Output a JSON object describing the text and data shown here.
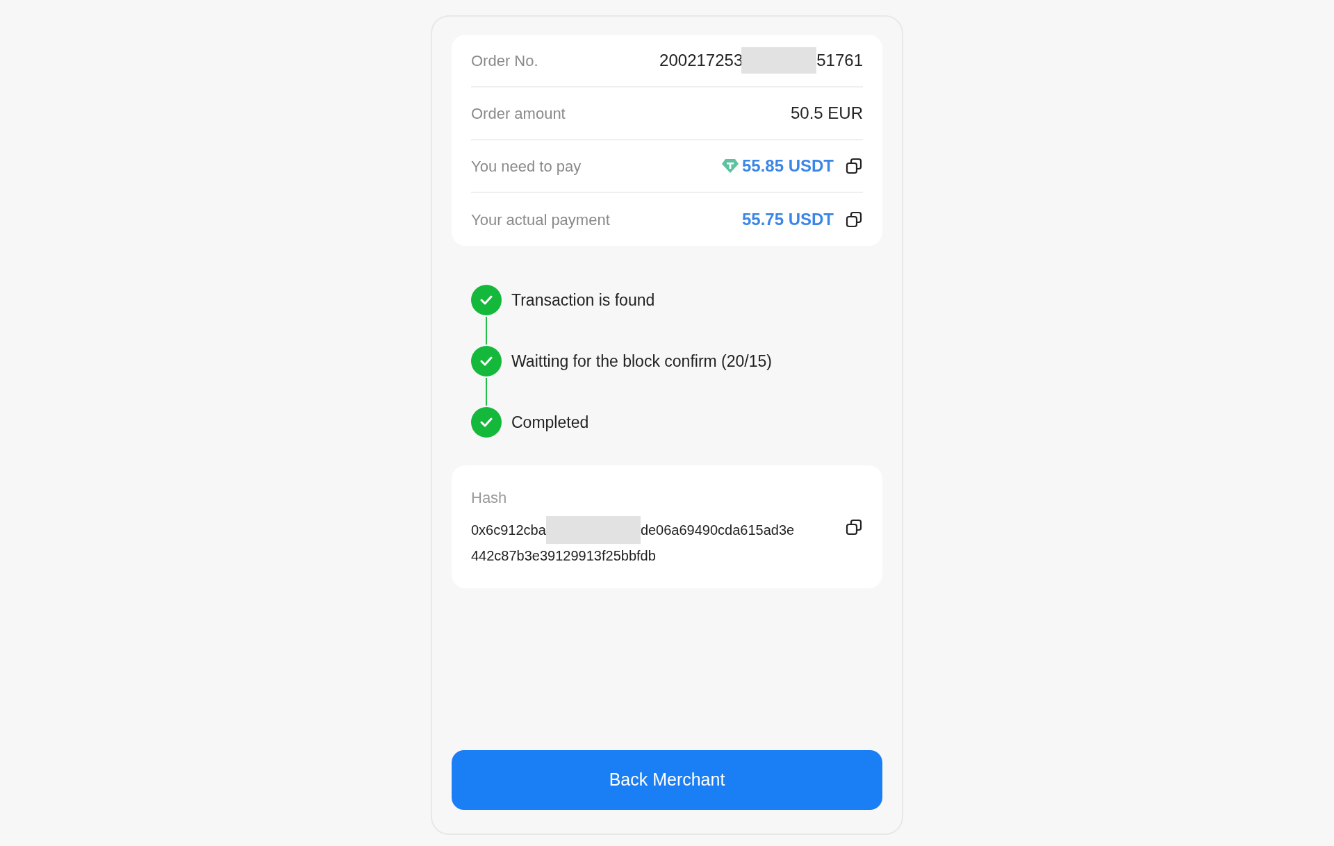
{
  "order_info": {
    "rows": [
      {
        "kind": "order_no",
        "label": "Order No.",
        "value_start": "200217253",
        "value_end": "51761"
      },
      {
        "kind": "plain",
        "label": "Order amount",
        "value": "50.5 EUR"
      },
      {
        "kind": "token",
        "label": "You need to pay",
        "value": "55.85 USDT",
        "copyable": true
      },
      {
        "kind": "amount",
        "label": "Your actual payment",
        "value": "55.75 USDT",
        "copyable": true
      }
    ]
  },
  "steps": [
    {
      "label": "Transaction is found",
      "done": true
    },
    {
      "label": "Waitting for the block confirm (20/15)",
      "done": true
    },
    {
      "label": "Completed",
      "done": true
    }
  ],
  "hash": {
    "label": "Hash",
    "line_1_start": "0x6c912cba",
    "line_1_end": "de06a69490cda615ad3e",
    "line_2": "442c87b3e39129913f25bbfdb",
    "copyable": true
  },
  "button": "Back Merchant"
}
